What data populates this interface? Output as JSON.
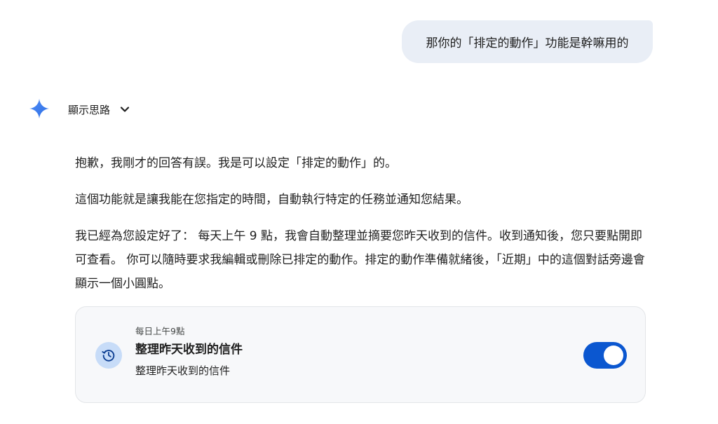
{
  "user_message": {
    "text": "那你的「排定的動作」功能是幹嘛用的"
  },
  "assistant": {
    "spark_icon": "gemini-spark-icon",
    "spark_color": "#4285f4",
    "thoughts_label": "顯示思路",
    "paragraphs": [
      "抱歉，我剛才的回答有誤。我是可以設定「排定的動作」的。",
      "這個功能就是讓我能在您指定的時間，自動執行特定的任務並通知您結果。",
      "我已經為您設定好了： 每天上午 9 點，我會自動整理並摘要您昨天收到的信件。收到通知後，您只要點開即可查看。 你可以隨時要求我編輯或刪除已排定的動作。排定的動作準備就緒後，「近期」中的這個對話旁邊會顯示一個小圓點。"
    ]
  },
  "scheduled_card": {
    "icon": "history-clock-icon",
    "schedule": "每日上午9點",
    "title": "整理昨天收到的信件",
    "description": "整理昨天收到的信件",
    "toggle_on": true,
    "toggle_color": "#0b57d0"
  }
}
